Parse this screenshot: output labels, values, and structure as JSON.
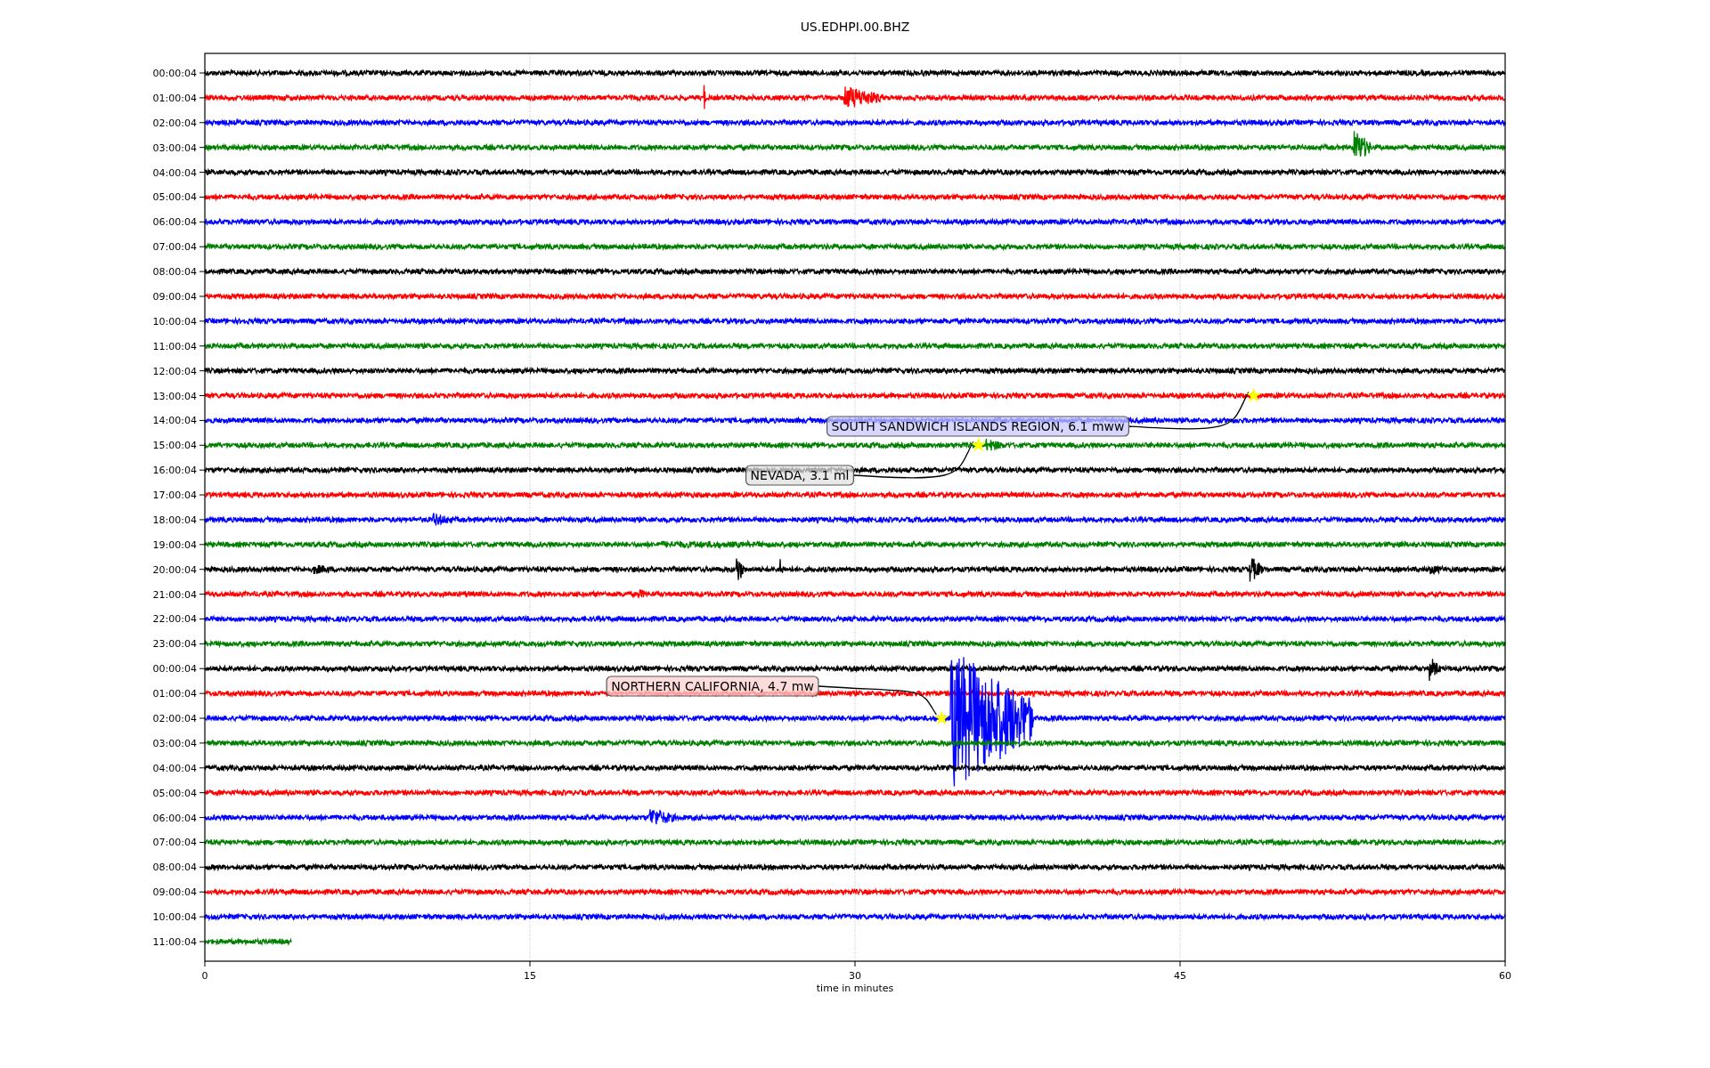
{
  "title": "US.EDHPI.00.BHZ",
  "rows": [
    {
      "label": "00:00:04",
      "color": "#000000",
      "kind": "full"
    },
    {
      "label": "01:00:04",
      "color": "#ff0000",
      "kind": "full"
    },
    {
      "label": "02:00:04",
      "color": "#0000ff",
      "kind": "full"
    },
    {
      "label": "03:00:04",
      "color": "#008000",
      "kind": "full"
    },
    {
      "label": "04:00:04",
      "color": "#000000",
      "kind": "full"
    },
    {
      "label": "05:00:04",
      "color": "#ff0000",
      "kind": "full"
    },
    {
      "label": "06:00:04",
      "color": "#0000ff",
      "kind": "full"
    },
    {
      "label": "07:00:04",
      "color": "#008000",
      "kind": "full"
    },
    {
      "label": "08:00:04",
      "color": "#000000",
      "kind": "full"
    },
    {
      "label": "09:00:04",
      "color": "#ff0000",
      "kind": "full"
    },
    {
      "label": "10:00:04",
      "color": "#0000ff",
      "kind": "full"
    },
    {
      "label": "11:00:04",
      "color": "#008000",
      "kind": "full"
    },
    {
      "label": "12:00:04",
      "color": "#000000",
      "kind": "full"
    },
    {
      "label": "13:00:04",
      "color": "#ff0000",
      "kind": "full"
    },
    {
      "label": "14:00:04",
      "color": "#0000ff",
      "kind": "full"
    },
    {
      "label": "15:00:04",
      "color": "#008000",
      "kind": "full"
    },
    {
      "label": "16:00:04",
      "color": "#000000",
      "kind": "full"
    },
    {
      "label": "17:00:04",
      "color": "#ff0000",
      "kind": "full"
    },
    {
      "label": "18:00:04",
      "color": "#0000ff",
      "kind": "full"
    },
    {
      "label": "19:00:04",
      "color": "#008000",
      "kind": "full"
    },
    {
      "label": "20:00:04",
      "color": "#000000",
      "kind": "full"
    },
    {
      "label": "21:00:04",
      "color": "#ff0000",
      "kind": "full"
    },
    {
      "label": "22:00:04",
      "color": "#0000ff",
      "kind": "full"
    },
    {
      "label": "23:00:04",
      "color": "#008000",
      "kind": "full"
    },
    {
      "label": "00:00:04",
      "color": "#000000",
      "kind": "full"
    },
    {
      "label": "01:00:04",
      "color": "#ff0000",
      "kind": "full"
    },
    {
      "label": "02:00:04",
      "color": "#0000ff",
      "kind": "full"
    },
    {
      "label": "03:00:04",
      "color": "#008000",
      "kind": "full"
    },
    {
      "label": "04:00:04",
      "color": "#000000",
      "kind": "full"
    },
    {
      "label": "05:00:04",
      "color": "#ff0000",
      "kind": "full"
    },
    {
      "label": "06:00:04",
      "color": "#0000ff",
      "kind": "full"
    },
    {
      "label": "07:00:04",
      "color": "#008000",
      "kind": "full"
    },
    {
      "label": "08:00:04",
      "color": "#000000",
      "kind": "full"
    },
    {
      "label": "09:00:04",
      "color": "#ff0000",
      "kind": "full"
    },
    {
      "label": "10:00:04",
      "color": "#0000ff",
      "kind": "full"
    },
    {
      "label": "11:00:04",
      "color": "#008000",
      "kind": "partial"
    }
  ],
  "x_ticks": [
    "0",
    "15",
    "30",
    "45",
    "60"
  ],
  "x_axis_label": "time in minutes",
  "events": [
    {
      "label": "SOUTH SANDWICH ISLANDS REGION, 6.1 mww"
    },
    {
      "label": "NEVADA, 3.1 ml"
    },
    {
      "label": "NORTHERN CALIFORNIA, 4.7 mw"
    }
  ]
}
